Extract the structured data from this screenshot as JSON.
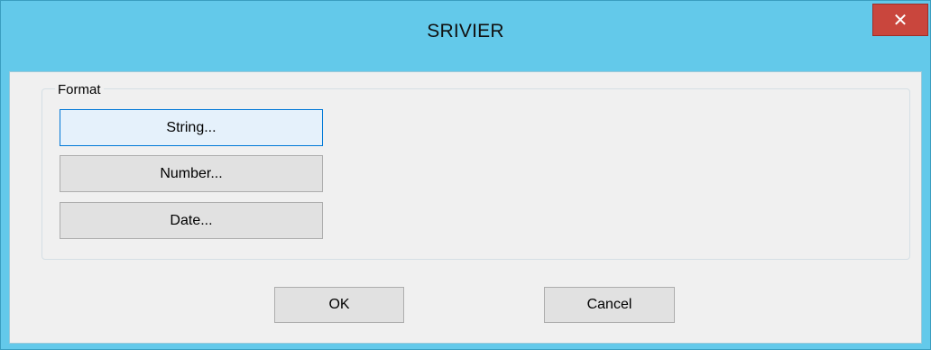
{
  "window": {
    "title": "SRIVIER",
    "close_icon": "close-icon"
  },
  "format_group": {
    "label": "Format",
    "buttons": [
      {
        "label": "String...",
        "focused": true
      },
      {
        "label": "Number...",
        "focused": false
      },
      {
        "label": "Date...",
        "focused": false
      }
    ]
  },
  "footer": {
    "ok_label": "OK",
    "cancel_label": "Cancel"
  },
  "colors": {
    "titlebar": "#63c9ea",
    "close_button": "#c9463d",
    "client_background": "#f0f0f0",
    "button_face": "#e1e1e1",
    "focus_border": "#0078d7"
  }
}
